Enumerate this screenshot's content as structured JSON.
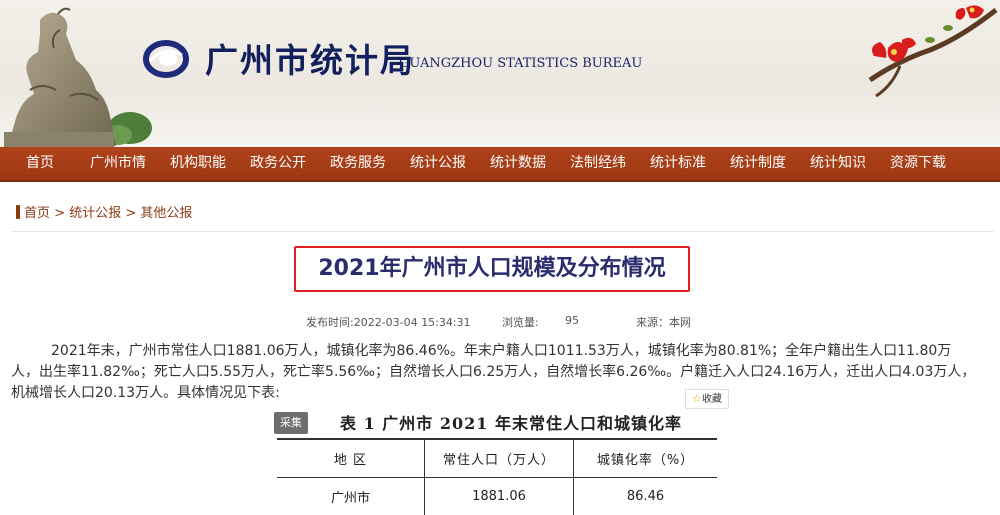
{
  "header": {
    "site_title": "广州市统计局",
    "site_subtitle": "GUANGZHOU STATISTICS BUREAU"
  },
  "nav": [
    "首页",
    "广州市情",
    "机构职能",
    "政务公开",
    "政务服务",
    "统计公报",
    "统计数据",
    "法制经纬",
    "统计标准",
    "统计制度",
    "统计知识",
    "资源下载"
  ],
  "breadcrumb": {
    "home": "首页",
    "sep1": " > ",
    "level2": "统计公报",
    "sep2": " > ",
    "level3": "其他公报"
  },
  "article": {
    "title": "2021年广州市人口规模及分布情况",
    "publish_time": "发布时间:2022-03-04 15:34:31",
    "views_label": "浏览量:",
    "views": "95",
    "source": "来源：本网",
    "body": "2021年末，广州市常住人口1881.06万人，城镇化率为86.46%。年末户籍人口1011.53万人，城镇化率为80.81%；全年户籍出生人口11.80万人，出生率11.82‰；死亡人口5.55万人，死亡率5.56‰；自然增长人口6.25万人，自然增长率6.26‰。户籍迁入人口24.16万人，迁出人口4.03万人，机械增长人口20.13万人。具体情况见下表:",
    "favorite": "收藏",
    "collect": "采集"
  },
  "table": {
    "caption": "表 1  广州市 2021 年末常住人口和城镇化率",
    "headers": [
      "地    区",
      "常住人口（万人）",
      "城镇化率（%）"
    ],
    "rows": [
      [
        "广州市",
        "1881.06",
        "86.46"
      ]
    ]
  }
}
